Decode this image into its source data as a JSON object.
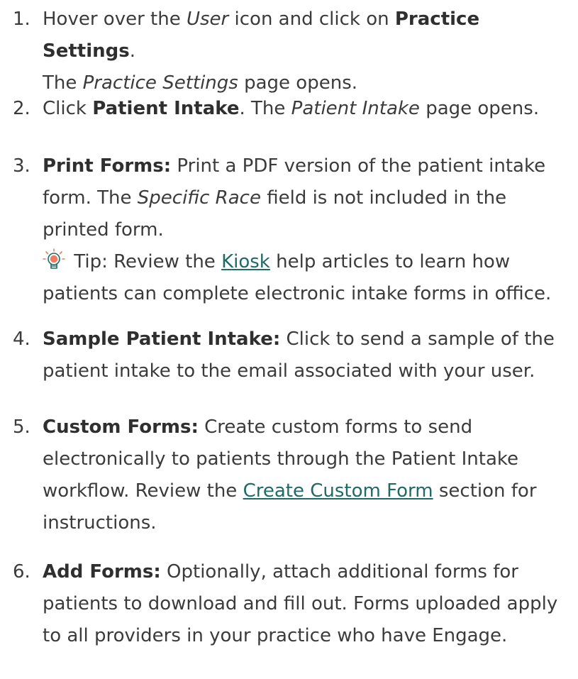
{
  "steps": [
    {
      "number": "1.",
      "t1": "Hover over the ",
      "em1": "User",
      "t2": " icon and click on ",
      "strong": "Practice Settings",
      "t3": ".",
      "t4": "The ",
      "em2": "Practice Settings",
      "t5": " page opens."
    },
    {
      "number": "2.",
      "t1": "Click ",
      "strong": "Patient Intake",
      "t2": ". The ",
      "em1": "Patient Intake",
      "t3": " page opens."
    },
    {
      "number": "3.",
      "strong": "Print Forms:",
      "t1": " Print a PDF version of the patient intake form. The ",
      "em1": "Specific Race",
      "t2": " field is not included in the printed form.",
      "tip_pre": " Tip: Review the ",
      "tip_link": "Kiosk",
      "tip_post": " help articles to learn how patients can complete electronic intake forms in office."
    },
    {
      "number": "4.",
      "strong": "Sample Patient Intake:",
      "t1": " Click to send a sample of the patient intake to the email associated with your user."
    },
    {
      "number": "5.",
      "strong": "Custom Forms:",
      "t1": " Create custom forms to send electronically to patients through the Patient Intake workflow. Review the ",
      "link": "Create Custom Form",
      "t2": " section for instructions."
    },
    {
      "number": "6.",
      "strong": "Add Forms:",
      "t1": " Optionally, attach additional forms for patients to download and fill out. Forms uploaded apply to all providers in your practice who have Engage."
    }
  ],
  "icons": {
    "tip": "lightbulb-icon"
  },
  "colors": {
    "text": "#3b3b3b",
    "link": "#1e6a66",
    "bulb": "#f07a5a"
  }
}
